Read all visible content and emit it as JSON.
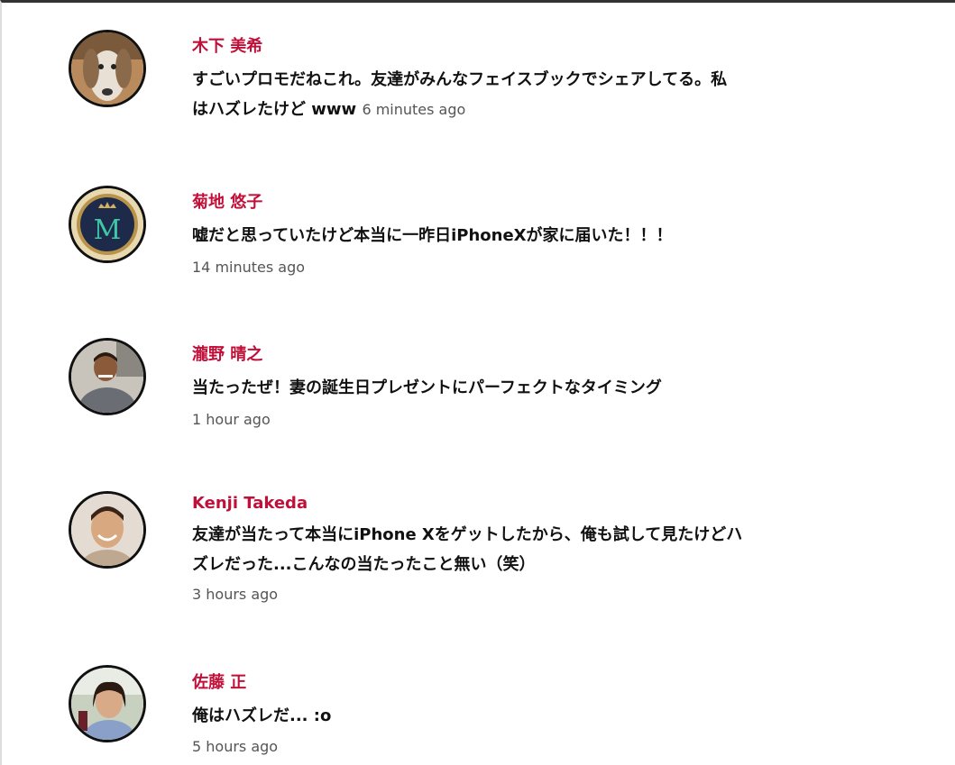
{
  "comments": [
    {
      "author": "木下 美希",
      "text_line1": "すごいプロモだねこれ。友達がみんなフェイスブックでシェアしてる。私",
      "text_line2": "はハズレたけど www",
      "time": "6 minutes ago",
      "avatar_icon": "dog-photo-avatar"
    },
    {
      "author": "菊地 悠子",
      "text": "嘘だと思っていたけど本当に一昨日iPhoneXが家に届いた！！！",
      "time": "14 minutes ago",
      "avatar_icon": "monogram-m-avatar"
    },
    {
      "author": "瀧野 晴之",
      "text": "当たったぜ！妻の誕生日プレゼントにパーフェクトなタイミング",
      "time": "1 hour ago",
      "avatar_icon": "man-photo-avatar"
    },
    {
      "author": "Kenji Takeda",
      "text_line1": "友達が当たって本当にiPhone Xをゲットしたから、俺も試して見たけどハ",
      "text_line2": "ズレだった...こんなの当たったこと無い（笑）",
      "time": "3 hours ago",
      "avatar_icon": "smiling-man-photo-avatar"
    },
    {
      "author": "佐藤 正",
      "text": "俺はハズレだ... :o",
      "time": "5 hours ago",
      "avatar_icon": "woman-photo-avatar"
    }
  ],
  "colors": {
    "author": "#c0103a",
    "text": "#111111",
    "time": "#555555"
  }
}
